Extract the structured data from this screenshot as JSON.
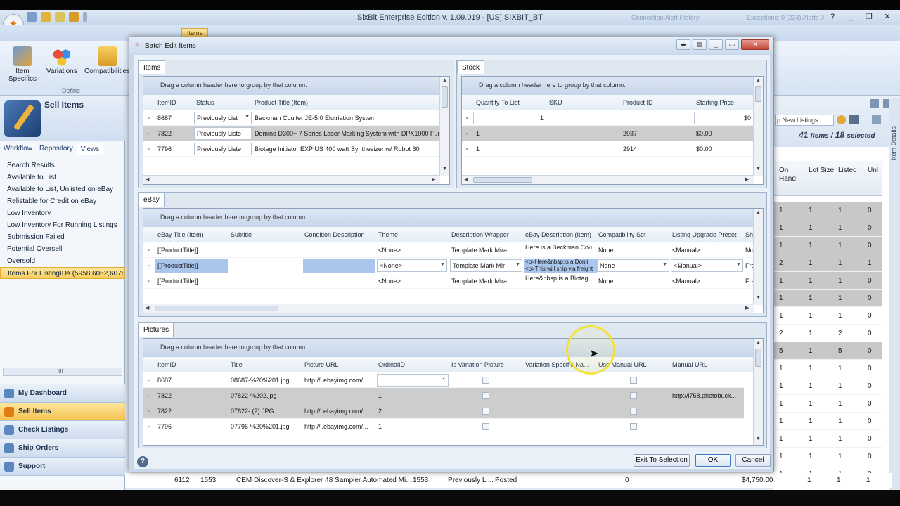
{
  "app": {
    "title": "SixBit Enterprise Edition v. 1.09.019 - [US] SIXBIT_BT",
    "faint_left": "Connection Alert History",
    "faint_right": "Exceptions: 0 (234) Alerts 0",
    "min": "_",
    "restore": "❐",
    "close": "✕",
    "help": "?"
  },
  "ribbon": {
    "active_tab": "Items",
    "buttons": [
      {
        "label1": "Item",
        "label2": "Specifics"
      },
      {
        "label1": "Variations",
        "label2": ""
      },
      {
        "label1": "Compatibilities",
        "label2": ""
      }
    ],
    "group_label": "Define"
  },
  "leftnav": {
    "title": "Sell Items",
    "tabs": [
      "Workflow",
      "Repository",
      "Views"
    ],
    "views": [
      "Search Results",
      "Available to List",
      "Available to List, Unlisted on eBay",
      "Relistable for Credit on eBay",
      "Low Inventory",
      "Low Inventory For Running Listings",
      "Submission Failed",
      "Potential Oversell",
      "Oversold",
      "Items For ListingIDs (5958,6062,6078,"
    ],
    "scroll_marker": "III",
    "buttons": [
      "My Dashboard",
      "Sell Items",
      "Check Listings",
      "Ship Orders",
      "Support"
    ]
  },
  "bgright": {
    "combo": "p New Listings",
    "count_items": "41",
    "count_items_label": "Items /",
    "count_selected": "18",
    "count_selected_label": "selected",
    "vtab": "Item Details",
    "headers": [
      "On Hand",
      "Lot Size",
      "Listed",
      "Unl"
    ],
    "rows": [
      {
        "c1": "1",
        "c2": "1",
        "c3": "1",
        "c4": "0",
        "gray": true
      },
      {
        "c1": "1",
        "c2": "1",
        "c3": "1",
        "c4": "0",
        "gray": true
      },
      {
        "c1": "1",
        "c2": "1",
        "c3": "1",
        "c4": "0",
        "gray": true
      },
      {
        "c1": "2",
        "c2": "1",
        "c3": "1",
        "c4": "1",
        "gray": true
      },
      {
        "c1": "1",
        "c2": "1",
        "c3": "1",
        "c4": "0",
        "gray": true
      },
      {
        "c1": "1",
        "c2": "1",
        "c3": "1",
        "c4": "0",
        "gray": true
      },
      {
        "c1": "1",
        "c2": "1",
        "c3": "1",
        "c4": "0",
        "gray": false
      },
      {
        "c1": "2",
        "c2": "1",
        "c3": "2",
        "c4": "0",
        "gray": false
      },
      {
        "c1": "5",
        "c2": "1",
        "c3": "5",
        "c4": "0",
        "gray": true
      },
      {
        "c1": "1",
        "c2": "1",
        "c3": "1",
        "c4": "0",
        "gray": false
      },
      {
        "c1": "1",
        "c2": "1",
        "c3": "1",
        "c4": "0",
        "gray": false
      },
      {
        "c1": "1",
        "c2": "1",
        "c3": "1",
        "c4": "0",
        "gray": false
      },
      {
        "c1": "1",
        "c2": "1",
        "c3": "1",
        "c4": "0",
        "gray": false
      },
      {
        "c1": "1",
        "c2": "1",
        "c3": "1",
        "c4": "0",
        "gray": false
      },
      {
        "c1": "1",
        "c2": "1",
        "c3": "1",
        "c4": "0",
        "gray": false
      },
      {
        "c1": "1",
        "c2": "1",
        "c3": "1",
        "c4": "0",
        "gray": false
      }
    ],
    "bottom_row": {
      "id": "6112",
      "num": "1553",
      "title": "CEM Discover-S & Explorer 48 Sampler Automated Mi...",
      "num2": "1553",
      "status": "Previously Li...",
      "status2": "Posted",
      "qty": "0",
      "price": "$4,750.00",
      "c1": "1",
      "c2": "1",
      "c3": "1",
      "c4": "0"
    }
  },
  "dialog": {
    "title": "Batch Edit Items",
    "buttons": {
      "exit": "Exit To Selection",
      "ok": "OK",
      "cancel": "Cancel"
    },
    "group_hint": "Drag a column header here to group by that column.",
    "items": {
      "tab": "Items",
      "columns": [
        "ItemID",
        "Status",
        "Product Title (Item)"
      ],
      "rows": [
        {
          "id": "8687",
          "status": "Previously List",
          "title": "Beckman Coulter JE-5.0 Elutriation System",
          "gray": false
        },
        {
          "id": "7822",
          "status": "Previously Liste",
          "title": "Domino D300+ 7 Series Laser Marking System with DPX1000 Fume Ex",
          "gray": true
        },
        {
          "id": "7796",
          "status": "Previously Liste",
          "title": "Biotage Initiator EXP US 400 watt Synthesizer w/ Robot 60",
          "gray": false
        }
      ]
    },
    "stock": {
      "tab": "Stock",
      "columns": [
        "Quantity To List",
        "SKU",
        "Product ID",
        "Starting Price"
      ],
      "rows": [
        {
          "qty": "1",
          "sku": "",
          "pid": "",
          "price": "$0",
          "gray": false
        },
        {
          "qty": "1",
          "sku": "",
          "pid": "2937",
          "price": "$0.00",
          "gray": true
        },
        {
          "qty": "1",
          "sku": "",
          "pid": "2914",
          "price": "$0.00",
          "gray": false
        }
      ]
    },
    "ebay": {
      "tab": "eBay",
      "columns": [
        "eBay Title (Item)",
        "Subtitle",
        "Condition Description",
        "Theme",
        "Description Wrapper",
        "eBay Description (Item)",
        "Compatibility Set",
        "Listing Upgrade Preset",
        "Sh"
      ],
      "rows": [
        {
          "title": "[[ProductTitle]]",
          "theme": "<None>",
          "wrapper": "Template Mark Mira",
          "desc": "Here is a Beckman Cou...",
          "compat": "None",
          "upgrade": "<Manual>",
          "sh": "Nc"
        },
        {
          "title": "[[ProductTitle]]",
          "theme": "<None>",
          "wrapper": "Template Mark Mir",
          "desc": "<p>Here&nbsp;is a Domi",
          "desc2": "<p>This will ship via freight",
          "compat": "None",
          "upgrade": "<Manual>",
          "sh": "Fre"
        },
        {
          "title": "[[ProductTitle]]",
          "theme": "<None>",
          "wrapper": "Template Mark Mira",
          "desc": "Here&nbsp;is a Biotag...",
          "compat": "None",
          "upgrade": "<Manual>",
          "sh": "Fre"
        }
      ]
    },
    "pictures": {
      "tab": "Pictures",
      "columns": [
        "ItemID",
        "Title",
        "Picture URL",
        "OrdinalID",
        "Is Variation Picture",
        "Variation Specific Na...",
        "Use Manual URL",
        "Manual URL"
      ],
      "rows": [
        {
          "id": "8687",
          "title": "08687-%20%201.jpg",
          "url": "http://i.ebayimg.com/...",
          "ord": "1",
          "manual": "",
          "gray": false
        },
        {
          "id": "7822",
          "title": "07822-%202.jpg",
          "url": "",
          "ord": "1",
          "manual": "http://i758.photobuck...",
          "gray": true
        },
        {
          "id": "7822",
          "title": "07822- (2).JPG",
          "url": "http://i.ebayimg.com/...",
          "ord": "2",
          "manual": "",
          "gray": true
        },
        {
          "id": "7796",
          "title": "07796-%20%201.jpg",
          "url": "http://i.ebayimg.com/...",
          "ord": "1",
          "manual": "",
          "gray": false
        }
      ]
    }
  }
}
